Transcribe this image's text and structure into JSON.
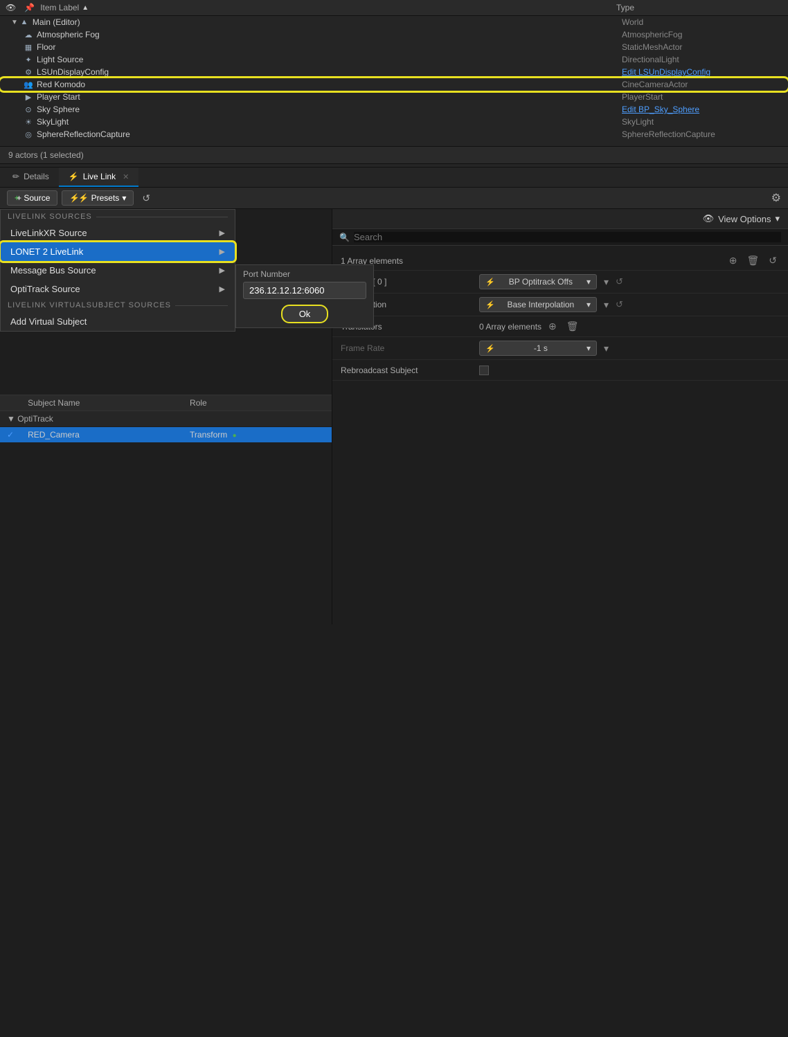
{
  "outliner": {
    "columns": [
      "Item Label",
      "Type"
    ],
    "sort_col": "Item Label",
    "sort_dir": "asc",
    "items": [
      {
        "indent": 1,
        "icon": "▲",
        "name": "Main (Editor)",
        "type": "World",
        "type_link": false,
        "selected": false,
        "highlighted": false
      },
      {
        "indent": 2,
        "icon": "☁",
        "name": "Atmospheric Fog",
        "type": "AtmosphericFog",
        "type_link": false,
        "selected": false,
        "highlighted": false
      },
      {
        "indent": 2,
        "icon": "▦",
        "name": "Floor",
        "type": "StaticMeshActor",
        "type_link": false,
        "selected": false,
        "highlighted": false
      },
      {
        "indent": 2,
        "icon": "✦",
        "name": "Light Source",
        "type": "DirectionalLight",
        "type_link": false,
        "selected": false,
        "highlighted": false
      },
      {
        "indent": 2,
        "icon": "⚙",
        "name": "LSUnDisplayConfig",
        "type": "Edit LSUnDisplayConfig",
        "type_link": true,
        "selected": false,
        "highlighted": false
      },
      {
        "indent": 2,
        "icon": "👥",
        "name": "Red Komodo",
        "type": "CineCameraActor",
        "type_link": false,
        "selected": false,
        "highlighted": true
      },
      {
        "indent": 2,
        "icon": "▶",
        "name": "Player Start",
        "type": "PlayerStart",
        "type_link": false,
        "selected": false,
        "highlighted": false
      },
      {
        "indent": 2,
        "icon": "⊙",
        "name": "Sky Sphere",
        "type": "Edit BP_Sky_Sphere",
        "type_link": true,
        "selected": false,
        "highlighted": false
      },
      {
        "indent": 2,
        "icon": "☀",
        "name": "SkyLight",
        "type": "SkyLight",
        "type_link": false,
        "selected": false,
        "highlighted": false
      },
      {
        "indent": 2,
        "icon": "◎",
        "name": "SphereReflectionCapture",
        "type": "SphereReflectionCapture",
        "type_link": false,
        "selected": false,
        "highlighted": false
      }
    ],
    "actor_count": "9 actors (1 selected)"
  },
  "tabs": [
    {
      "label": "Details",
      "icon": "✏",
      "active": false,
      "closable": false
    },
    {
      "label": "Live Link",
      "icon": "⚡",
      "active": true,
      "closable": true
    }
  ],
  "toolbar": {
    "source_label": "+ Source",
    "presets_label": "⚡ Presets",
    "presets_arrow": "▾",
    "reset_icon": "↺",
    "gear_icon": "⚙"
  },
  "source_popup": {
    "section1_label": "LIVELINK SOURCES",
    "sources": [
      {
        "name": "LiveLinkXR Source",
        "has_sub": true,
        "active": false
      },
      {
        "name": "LONET 2 LiveLink",
        "has_sub": true,
        "active": true
      },
      {
        "name": "Message Bus Source",
        "has_sub": true,
        "active": false
      },
      {
        "name": "OptiTrack Source",
        "has_sub": true,
        "active": false
      }
    ],
    "section2_label": "LIVELINK VIRTUALSUBJECT SOURCES",
    "virtual_sources": [
      {
        "name": "Add Virtual Subject",
        "has_sub": false,
        "active": false
      }
    ]
  },
  "port_popup": {
    "label": "Port Number",
    "value": "236.12.12.12:6060",
    "ok_label": "Ok"
  },
  "subject_table": {
    "columns": [
      "",
      "Subject Name",
      "Role"
    ],
    "groups": [
      {
        "name": "OptiTrack",
        "subjects": [
          {
            "checked": true,
            "name": "RED_Camera",
            "role": "Transform",
            "active": true
          }
        ]
      }
    ]
  },
  "right_panel": {
    "view_options_label": "View Options",
    "search_placeholder": "Search",
    "sections": [
      {
        "label": "1 Array elements",
        "has_add": true,
        "has_delete": true,
        "has_reset": true,
        "items": [
          {
            "label": "Index [ 0 ]",
            "value_type": "dropdown",
            "value": "BP Optitrack Offs",
            "has_expand": true,
            "has_chevron": true,
            "has_reset": true
          },
          {
            "label": "Interpolation",
            "value_type": "dropdown",
            "value": "Base Interpolation",
            "has_expand": false,
            "has_chevron": true,
            "has_reset": true
          },
          {
            "label": "Translators",
            "value_type": "text",
            "value": "0 Array elements",
            "has_add": true,
            "has_delete": true,
            "has_reset": false
          },
          {
            "label": "Frame Rate",
            "value_type": "dropdown",
            "value": "-1 s",
            "has_expand": false,
            "has_chevron": true,
            "has_reset": false,
            "dimmed": true
          },
          {
            "label": "Rebroadcast Subject",
            "value_type": "checkbox",
            "value": false,
            "has_reset": false
          }
        ]
      }
    ]
  }
}
